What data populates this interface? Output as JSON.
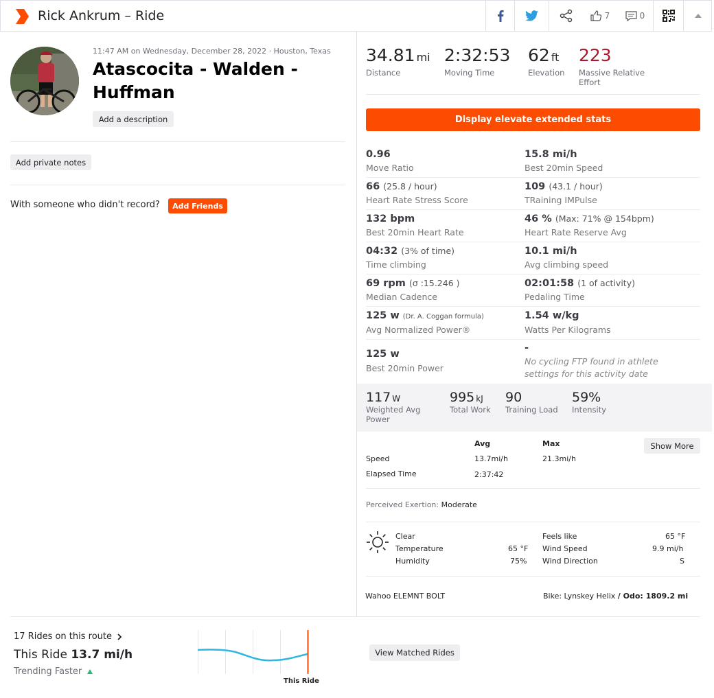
{
  "header": {
    "title": "Rick Ankrum – Ride",
    "kudos_count": "7",
    "comments_count": "0"
  },
  "activity": {
    "date": "11:47 AM on Wednesday, December 28, 2022 · Houston, Texas",
    "title": "Atascocita - Walden - Huffman",
    "add_description": "Add a description",
    "add_private_notes": "Add private notes",
    "with_someone": "With someone who didn't record?",
    "add_friends": "Add Friends"
  },
  "stats": {
    "distance": {
      "value": "34.81",
      "unit": "mi",
      "label": "Distance"
    },
    "moving_time": {
      "value": "2:32:53",
      "label": "Moving Time"
    },
    "elevation": {
      "value": "62",
      "unit": "ft",
      "label": "Elevation"
    },
    "relative_effort": {
      "value": "223",
      "label": "Massive Relative Effort"
    }
  },
  "elevate_button": "Display elevate extended stats",
  "extended": {
    "move_ratio": {
      "value": "0.96",
      "label": "Move Ratio"
    },
    "best20_speed": {
      "value": "15.8 mi/h",
      "label": "Best 20min Speed"
    },
    "hrss": {
      "value": "66",
      "extra": "(25.8 / hour)",
      "label": "Heart Rate Stress Score"
    },
    "trimp": {
      "value": "109",
      "extra": "(43.1 / hour)",
      "label": "TRaining IMPulse"
    },
    "best20_hr": {
      "value": "132 bpm",
      "label": "Best 20min Heart Rate"
    },
    "hrr": {
      "value": "46 %",
      "extra": "(Max: 71% @ 154bpm)",
      "label": "Heart Rate Reserve Avg"
    },
    "time_climbing": {
      "value": "04:32",
      "extra": "(3% of time)",
      "label": "Time climbing"
    },
    "climb_speed": {
      "value": "10.1 mi/h",
      "label": "Avg climbing speed"
    },
    "cadence": {
      "value": "69 rpm",
      "extra": "(σ :15.246 )",
      "label": "Median Cadence"
    },
    "pedaling": {
      "value": "02:01:58",
      "extra": "(1 of activity)",
      "label": "Pedaling Time"
    },
    "np": {
      "value": "125 w",
      "extra": "(Dr. A. Coggan formula)",
      "label": "Avg Normalized Power®"
    },
    "wkg": {
      "value": "1.54 w/kg",
      "label": "Watts Per Kilograms"
    },
    "best20_power": {
      "value": "125 w",
      "label": "Best 20min Power"
    },
    "ftp": {
      "value": "-",
      "note": "No cycling FTP found in athlete settings for this activity date"
    }
  },
  "power": {
    "weighted": {
      "value": "117",
      "unit": "W",
      "label": "Weighted Avg Power"
    },
    "work": {
      "value": "995",
      "unit": "kJ",
      "label": "Total Work"
    },
    "load": {
      "value": "90",
      "label": "Training Load"
    },
    "intensity": {
      "value": "59%",
      "label": "Intensity"
    }
  },
  "table": {
    "avg_header": "Avg",
    "max_header": "Max",
    "show_more": "Show More",
    "speed_label": "Speed",
    "speed_avg": "13.7mi/h",
    "speed_max": "21.3mi/h",
    "elapsed_label": "Elapsed Time",
    "elapsed_avg": "2:37:42"
  },
  "exertion": {
    "label": "Perceived Exertion:",
    "value": "Moderate"
  },
  "weather": {
    "condition": "Clear",
    "temperature_label": "Temperature",
    "temperature": "65 °F",
    "humidity_label": "Humidity",
    "humidity": "75%",
    "feels_label": "Feels like",
    "feels": "65 °F",
    "wind_speed_label": "Wind Speed",
    "wind_speed": "9.9 mi/h",
    "wind_dir_label": "Wind Direction",
    "wind_dir": "S"
  },
  "device": {
    "name": "Wahoo ELEMNT BOLT",
    "bike_label": "Bike: Lynskey Helix",
    "odo": "/ Odo: 1809.2 mi"
  },
  "route": {
    "rides_on_route": "17 Rides on this route",
    "this_ride_label": "This Ride",
    "this_ride_speed": "13.7 mi/h",
    "trending": "Trending Faster",
    "marker_label": "This Ride",
    "view_matched": "View Matched Rides"
  },
  "colors": {
    "accent": "#fc4c02",
    "effort": "#a8192e",
    "trend_line": "#30b7e0"
  }
}
